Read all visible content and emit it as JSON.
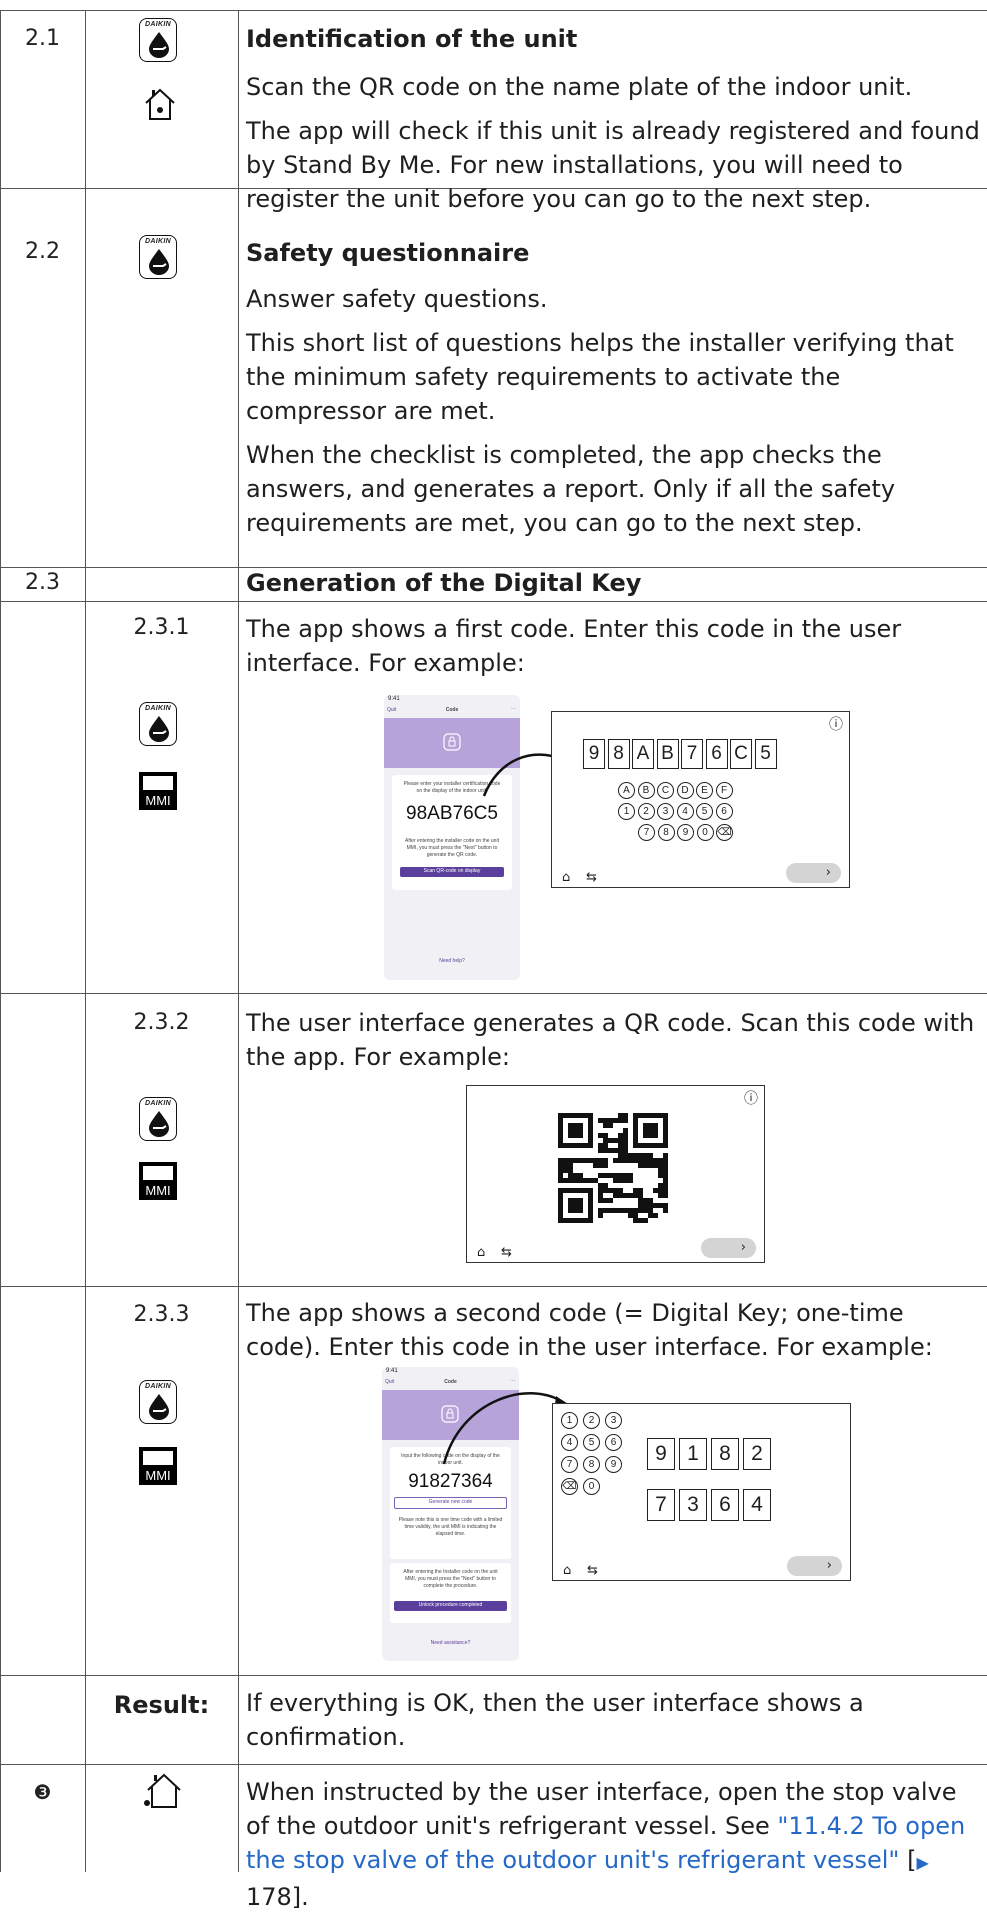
{
  "rows": [
    {
      "number": "2.1",
      "title": "Identification of the unit",
      "paragraphs": [
        "Scan the QR code on the name plate of the indoor unit.",
        "The app will check if this unit is already registered and found by Stand By Me. For new installations, you will need to register the unit before you can go to the next step."
      ]
    },
    {
      "number": "2.2",
      "title": "Safety questionnaire",
      "paragraphs": [
        "Answer safety questions.",
        "This short list of questions helps the installer verifying that the minimum safety requirements to activate the compressor are met.",
        "When the checklist is completed, the app checks the answers, and generates a report. Only if all the safety requirements are met, you can go to the next step."
      ]
    },
    {
      "number": "2.3",
      "title": "Generation of the Digital Key"
    },
    {
      "number": "2.3.1",
      "text": "The app shows a first code. Enter this code in the user interface. For example:"
    },
    {
      "number": "2.3.2",
      "text": "The user interface generates a QR code. Scan this code with the app. For example:"
    },
    {
      "number": "2.3.3",
      "text": "The app shows a second code (= Digital Key; one-time code). Enter this code in the user interface. For example:"
    },
    {
      "label": "Result:",
      "text": "If everything is OK, then the user interface shows a confirmation."
    },
    {
      "number": "❸",
      "text_before": "When instructed by the user interface, open the stop valve of the outdoor unit's refrigerant vessel. See ",
      "link": "\"11.4.2 To open the stop valve of the outdoor unit's refrigerant vessel\"",
      "ref_open": " [",
      "ref_arrow": "▶",
      "ref_page": " 178]."
    }
  ],
  "icons": {
    "daikin_brand": "DAIKIN",
    "mmi_label": "MMI"
  },
  "figure1": {
    "phone": {
      "time": "9:41",
      "back": "Quit",
      "title": "Code",
      "more": "···",
      "instruction": "Please enter your installer certification code on the display of the indoor unit.",
      "code": "98AB76C5",
      "note": "After entering the installer code on the unit MMI, you must press the \"Next\" button to generate the QR code.",
      "button": "Scan QR-code on display",
      "help": "Need help?"
    },
    "ui": {
      "code_chars": [
        "9",
        "8",
        "A",
        "B",
        "7",
        "6",
        "C",
        "5"
      ],
      "keys_row1": [
        "A",
        "B",
        "C",
        "D",
        "E",
        "F"
      ],
      "keys_row2": [
        "1",
        "2",
        "3",
        "4",
        "5",
        "6"
      ],
      "keys_row3": [
        "7",
        "8",
        "9",
        "0",
        "⌫"
      ],
      "info": "ⓘ",
      "home": "⌂",
      "back": "⇆",
      "next": "›"
    }
  },
  "figure2": {
    "info": "ⓘ",
    "home": "⌂",
    "back": "⇆",
    "next": "›"
  },
  "figure3": {
    "phone": {
      "time": "9:41",
      "back": "Quit",
      "title": "Code",
      "more": "···",
      "instruction": "Input the following code on the display of the indoor unit.",
      "code": "91827364",
      "gen_button": "Generate new code",
      "note": "Please note this is one time code with a limited time validity, the unit MMI is indicating the elapsed time.",
      "note2": "After entering the Installer code on the unit MMI, you must press the \"Next\" button to complete the procedure.",
      "button": "Unlock procedure completed",
      "help": "Need assistance?"
    },
    "ui": {
      "keys": [
        "1",
        "2",
        "3",
        "4",
        "5",
        "6",
        "7",
        "8",
        "9",
        "⌫",
        "0"
      ],
      "code_row1": [
        "9",
        "1",
        "8",
        "2"
      ],
      "code_row2": [
        "7",
        "3",
        "6",
        "4"
      ],
      "home": "⌂",
      "back": "⇆",
      "next": "›"
    }
  }
}
